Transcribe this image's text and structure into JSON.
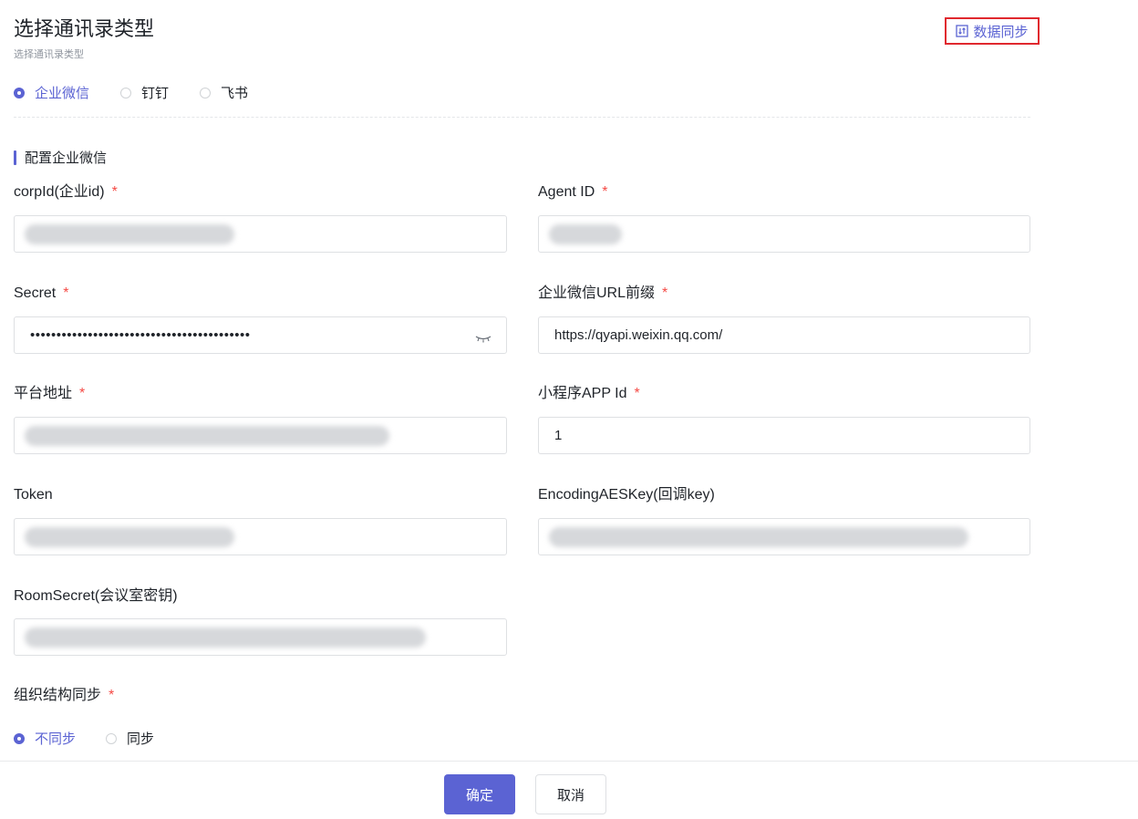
{
  "header": {
    "title": "选择通讯录类型",
    "subtitle": "选择通讯录类型",
    "sync_label": "数据同步"
  },
  "directory_types": [
    {
      "label": "企业微信",
      "checked": true
    },
    {
      "label": "钉钉",
      "checked": false
    },
    {
      "label": "飞书",
      "checked": false
    }
  ],
  "section": {
    "title": "配置企业微信"
  },
  "required_mark": "*",
  "fields": {
    "corp_id": {
      "label": "corpId(企业id)",
      "value": ""
    },
    "agent_id": {
      "label": "Agent ID",
      "value": ""
    },
    "secret": {
      "label": "Secret",
      "value": "••••••••••••••••••••••••••••••••••••••••••"
    },
    "url_prefix": {
      "label": "企业微信URL前缀",
      "value": "https://qyapi.weixin.qq.com/"
    },
    "platform_address": {
      "label": "平台地址",
      "value": ""
    },
    "mini_app_id": {
      "label": "小程序APP Id",
      "value": "1"
    },
    "token": {
      "label": "Token",
      "value": ""
    },
    "encoding_aes_key": {
      "label": "EncodingAESKey(回调key)",
      "value": ""
    },
    "room_secret": {
      "label": "RoomSecret(会议室密钥)",
      "value": ""
    }
  },
  "org_sync": {
    "label": "组织结构同步",
    "options": [
      {
        "label": "不同步",
        "checked": true
      },
      {
        "label": "同步",
        "checked": false
      }
    ]
  },
  "footer": {
    "confirm_label": "确定",
    "cancel_label": "取消"
  },
  "colors": {
    "accent": "#5b63d3",
    "required": "#f54a45",
    "highlight_border": "#e0282e"
  },
  "icons": {
    "sync": "sync-icon",
    "eye": "eye-closed-icon"
  }
}
